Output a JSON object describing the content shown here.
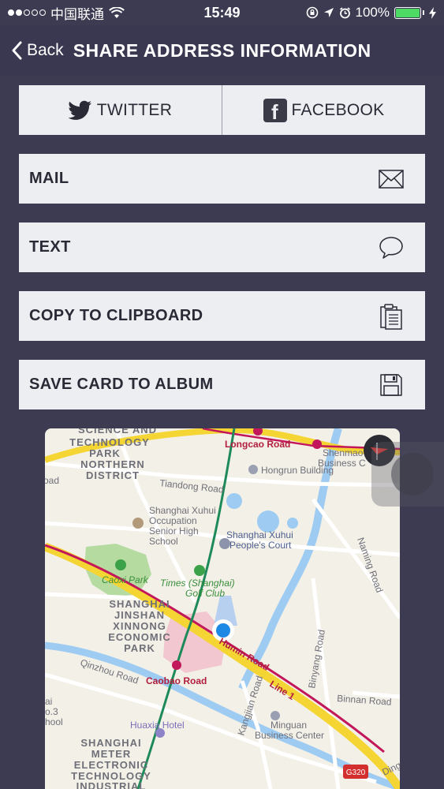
{
  "status_bar": {
    "carrier": "中国联通",
    "time": "15:49",
    "battery": "100%"
  },
  "nav": {
    "back_label": "Back",
    "title": "SHARE ADDRESS INFORMATION"
  },
  "share": {
    "twitter_label": "TWITTER",
    "facebook_label": "FACEBOOK",
    "mail_label": "MAIL",
    "text_label": "TEXT",
    "clipboard_label": "COPY TO CLIPBOARD",
    "save_label": "SAVE CARD TO ALBUM"
  },
  "map": {
    "labels": {
      "science_park_1": "SCIENCE AND",
      "science_park_2": "TECHNOLOGY",
      "science_park_3": "PARK",
      "northern_district_1": "NORTHERN",
      "northern_district_2": "DISTRICT",
      "longcao_road": "Longcao Road",
      "shenmao_1": "Shenmao",
      "shenmao_2": "Business C",
      "tiandong_road": "Tiandong Road",
      "hongrun": "Hongrun Building",
      "road_left": "oad",
      "occupation_1": "Shanghai Xuhui",
      "occupation_2": "Occupation",
      "occupation_3": "Senior High",
      "occupation_4": "School",
      "court_1": "Shanghai Xuhui",
      "court_2": "People's Court",
      "naming_road": "Naming Road",
      "caoxi_park": "Caoxi Park",
      "golf_1": "Times (Shanghai)",
      "golf_2": "Golf Club",
      "jinshan_1": "SHANGHAI",
      "jinshan_2": "JINSHAN",
      "jinshan_3": "XINNONG",
      "jinshan_4": "ECONOMIC",
      "jinshan_5": "PARK",
      "humin_road": "Humin Road",
      "binyang_road": "Binyang Road",
      "caobao_road": "Caobao Road",
      "line1": "Line 1",
      "qinzhou_road": "Qinzhou Road",
      "kangjian_road": "Kangjian Road",
      "binnan_road": "Binnan Road",
      "left_1": "ai",
      "left_2": "o.3",
      "left_3": "hool",
      "huaxia_hotel": "Huaxia Hotel",
      "minguan_1": "Minguan",
      "minguan_2": "Business Center",
      "meter_1": "SHANGHAI",
      "meter_2": "METER",
      "meter_3": "ELECTRONIC",
      "meter_4": "TECHNOLOGY",
      "meter_5": "INDUSTRIAL",
      "g320": "G320",
      "dingxi": "Ding"
    }
  },
  "colors": {
    "background": "#3d3b52",
    "button_bg": "#eceef1",
    "button_text": "#2a2a36",
    "battery": "#4cd964",
    "user_location": "#1e88e5",
    "metro_line": "#c2185b",
    "highway": "#f5d533"
  }
}
